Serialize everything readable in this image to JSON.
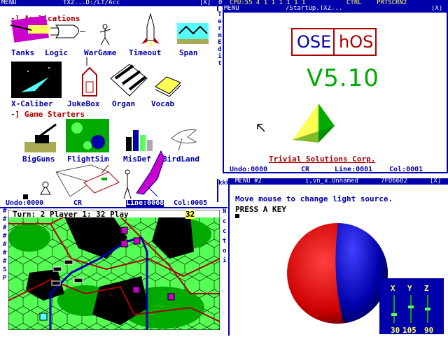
{
  "top_left_bar": {
    "menu": "MENU",
    "path": "TXZ...D:/LT/Acc",
    "close": "[X]"
  },
  "top_right_bar": {
    "zero": "0",
    "cpu": "CPU:55 4 1 1 1 1 1 1",
    "ctrl": "CTRL",
    "prtscrn": "PRTSCRN2",
    "menu": "MENU",
    "path": "/StartUp.TXZ...",
    "close": "[X]"
  },
  "apps_header": "-] Applications",
  "apps": [
    "Tanks",
    "Logic",
    "WarGame",
    "Timeout",
    "Span",
    "X-Caliber",
    "JukeBox",
    "Organ",
    "Vocab"
  ],
  "game_header": "-] Game Starters",
  "games": [
    "BigGuns",
    "FlightSim",
    "MisDef",
    "BirdLand"
  ],
  "left_status": {
    "undo": "Undo:0000",
    "cr": "CR",
    "line": "Line:0068",
    "col": "Col:0005"
  },
  "startup": {
    "logo_left": "OSE",
    "logo_right": "hOS",
    "version": "V5.10",
    "company": "Trivial Solutions Corp.",
    "status": {
      "undo": "Undo:0000",
      "cr": "CR",
      "line": "Line:0001",
      "col": "Col:0001"
    }
  },
  "side_labels": {
    "termedit": "TermEdit",
    "ktickets": "kkk",
    "more": "Ncctoi"
  },
  "wargame": {
    "turn_text": "Turn: 2 Player 1: 32 Play",
    "turn_num": "32"
  },
  "menu2": {
    "menu": "MENU #2",
    "path": "i,vn_x.Unnamed",
    "id": "7FD6602",
    "close": "[X]",
    "message": "Move mouse to change light source.",
    "prompt": "PRESS A KEY",
    "sliders": {
      "labels": [
        "X",
        "Y",
        "Z"
      ],
      "values": [
        "30",
        "105",
        "90"
      ],
      "levels": [
        0.3,
        0.58,
        0.5
      ]
    }
  },
  "colors": {
    "accent": "#0000aa",
    "red": "#aa0000",
    "green": "#00aa00",
    "yellow": "#ffff55"
  }
}
